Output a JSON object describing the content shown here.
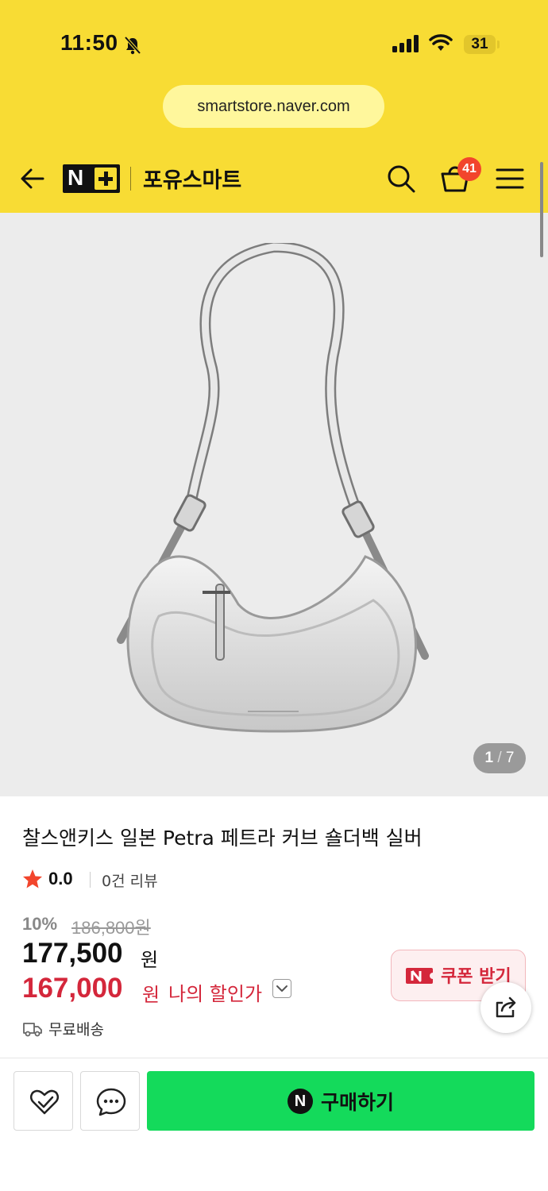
{
  "status_bar": {
    "time": "11:50",
    "battery": "31"
  },
  "browser": {
    "url": "smartstore.naver.com"
  },
  "header": {
    "logo_letter": "N",
    "store_name": "포유스마트",
    "cart_count": "41"
  },
  "gallery": {
    "current": "1",
    "separator": "/",
    "total": "7"
  },
  "product": {
    "title": "찰스앤키스 일본 Petra 페트라 커브 숄더백 실버",
    "rating": "0.0",
    "review_count": "0건 리뷰",
    "discount_rate": "10%",
    "original_price": "186,800원",
    "price": "177,500",
    "price_unit": "원",
    "my_price": "167,000",
    "my_price_unit": "원",
    "my_price_label": "나의 할인가",
    "coupon_label": "쿠폰 받기",
    "shipping": "무료배송"
  },
  "bottom_bar": {
    "buy_label": "구매하기",
    "buy_icon_letter": "N"
  },
  "colors": {
    "brand_yellow": "#f8dc34",
    "discount_red": "#d4273b",
    "buy_green": "#14da5b",
    "badge_orange": "#f2452c"
  }
}
